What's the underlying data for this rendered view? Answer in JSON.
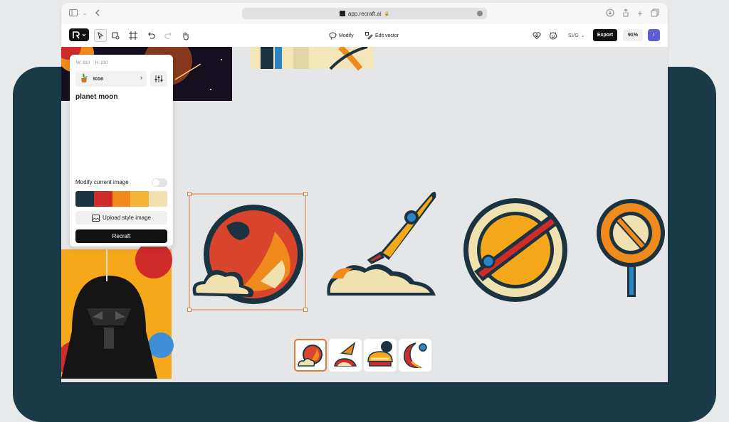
{
  "browser": {
    "url": "app.recraft.ai"
  },
  "toolbar": {
    "modify_label": "Modify",
    "edit_vector_label": "Edit vector",
    "format_label": "SVG",
    "export_label": "Export",
    "zoom_label": "91%",
    "avatar_initial": "I"
  },
  "panel": {
    "width_label": "W: 310",
    "height_label": "H: 310",
    "style_label": "Icon",
    "prompt": "planet moon",
    "modify_current_label": "Modify current image",
    "modify_current_enabled": false,
    "palette": [
      "#1b3340",
      "#d02b2b",
      "#f08a1c",
      "#f7b53a",
      "#efe1b0"
    ],
    "upload_style_label": "Upload style image",
    "recraft_label": "Recraft"
  },
  "thumbnails": [
    {
      "name": "planet-moon-cloud",
      "selected": true
    },
    {
      "name": "rocket-cloud",
      "selected": false
    },
    {
      "name": "planet-pie",
      "selected": false
    },
    {
      "name": "crescent-moon",
      "selected": false
    }
  ],
  "colors": {
    "accent": "#e07b35",
    "dark_bg": "#1a3a48",
    "primary_button": "#111111"
  }
}
